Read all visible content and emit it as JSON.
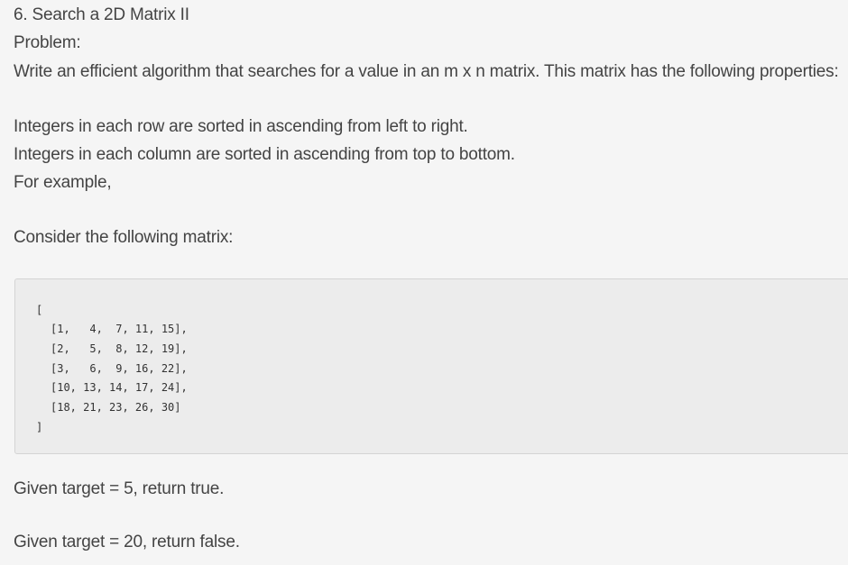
{
  "heading": "6. Search a 2D Matrix II",
  "problem_label": "Problem:",
  "description": "Write an efficient algorithm that searches for a value in an m x n matrix. This matrix has the following properties:",
  "properties": [
    "Integers in each row are sorted in ascending from left to right.",
    "Integers in each column are sorted in ascending from top to bottom."
  ],
  "example_intro": "For example,",
  "consider": "Consider the following matrix:",
  "code": {
    "open": "[",
    "rows": [
      "[1,   4,  7, 11, 15],",
      "[2,   5,  8, 12, 19],",
      "[3,   6,  9, 16, 22],",
      "[10, 13, 14, 17, 24],",
      "[18, 21, 23, 26, 30]"
    ],
    "close": "]"
  },
  "results": [
    "Given target = 5, return true.",
    "Given target = 20, return false."
  ]
}
